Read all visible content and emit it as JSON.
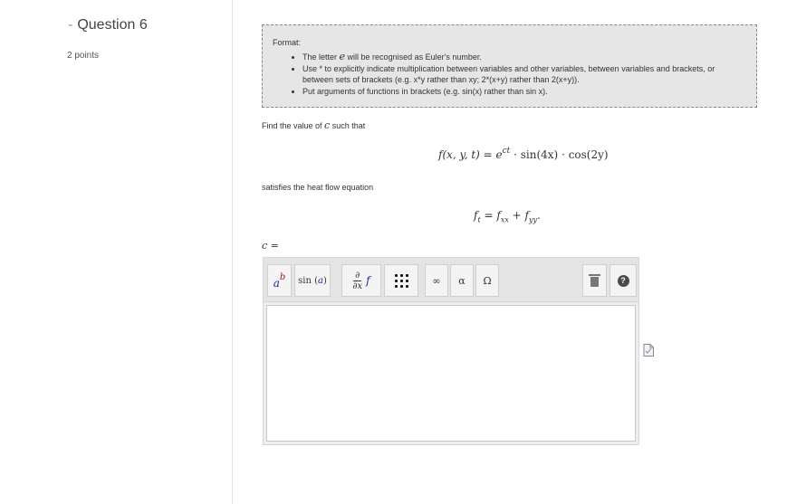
{
  "question": {
    "dash": "-",
    "title": "Question 6",
    "points": "2 points"
  },
  "format": {
    "heading": "Format:",
    "items": [
      {
        "before": "The letter ",
        "symbol": "e",
        "after": " will be recognised as Euler's number."
      },
      {
        "text": "Use * to explicitly indicate multiplication between variables and other variables, between variables and brackets, or between sets of brackets (e.g. x*y rather than xy; 2*(x+y) rather than 2(x+y))."
      },
      {
        "text": "Put arguments of functions in brackets (e.g. sin(x) rather than sin x)."
      }
    ]
  },
  "prompt": {
    "find_before": "Find the value of ",
    "find_var": "c",
    "find_after": " such that",
    "satisfies": "satisfies the heat flow equation"
  },
  "equation1": {
    "lhs": "f(x, y, t) = e",
    "exp": "ct",
    "dot1": " · ",
    "sin": "sin(4x)",
    "dot2": " · ",
    "cos": "cos(2y)"
  },
  "equation2": {
    "f1": "f",
    "s1": "t",
    "eq": " = ",
    "f2": "f",
    "s2": "xx",
    "plus": " + ",
    "f3": "f",
    "s3": "yy",
    "end": "."
  },
  "answer": {
    "label": "c =",
    "value": ""
  },
  "toolbar": {
    "power_base": "a",
    "power_exp": "b",
    "sin_fn": "sin",
    "sin_open": "(",
    "sin_arg": "a",
    "sin_close": ")",
    "deriv_num": "∂",
    "deriv_den": "∂x",
    "deriv_f": "f",
    "infinity": "∞",
    "alpha": "α",
    "omega": "Ω",
    "trash_icon": "trash-icon",
    "help_symbol": "?"
  }
}
